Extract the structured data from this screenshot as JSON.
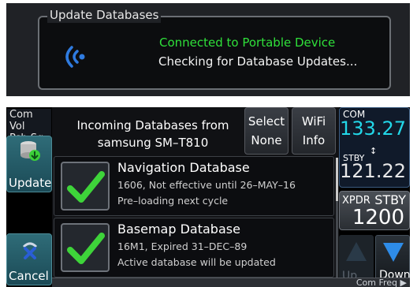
{
  "banner": {
    "title": "Update Databases",
    "status_line": "Connected to Portable Device",
    "message_line": "Checking for Database Updates...",
    "icon": "wireless-signal-icon",
    "status_color": "#2fe03a"
  },
  "left_panel": {
    "com_vol_label": "Com Vol\nPsh Sq",
    "update_label": "Update",
    "cancel_label": "Cancel"
  },
  "header": {
    "title": "Incoming Databases from samsung SM–T810",
    "select_none_label": "Select None",
    "wifi_info_label": "WiFi Info"
  },
  "databases": [
    {
      "name": "Navigation Database",
      "detail": "1606, Not effective until 26–MAY–16",
      "status": "Pre–loading next cycle",
      "checked": true
    },
    {
      "name": "Basemap Database",
      "detail": "16M1, Expired 31–DEC–89",
      "status": "Active database will be updated",
      "checked": true
    }
  ],
  "radio": {
    "com_label": "COM",
    "com_active": "133.27",
    "stby_label": "STBY",
    "com_standby": "121.22",
    "xpdr_label": "XPDR",
    "xpdr_mode": "STBY",
    "xpdr_code": "1200",
    "up_label": "Up",
    "down_label": "Down",
    "com_freq_label": "Com Freq"
  },
  "colors": {
    "checkmark": "#3ed43a",
    "active_freq": "#22d7e8",
    "button_teal": "#2f6c78"
  }
}
